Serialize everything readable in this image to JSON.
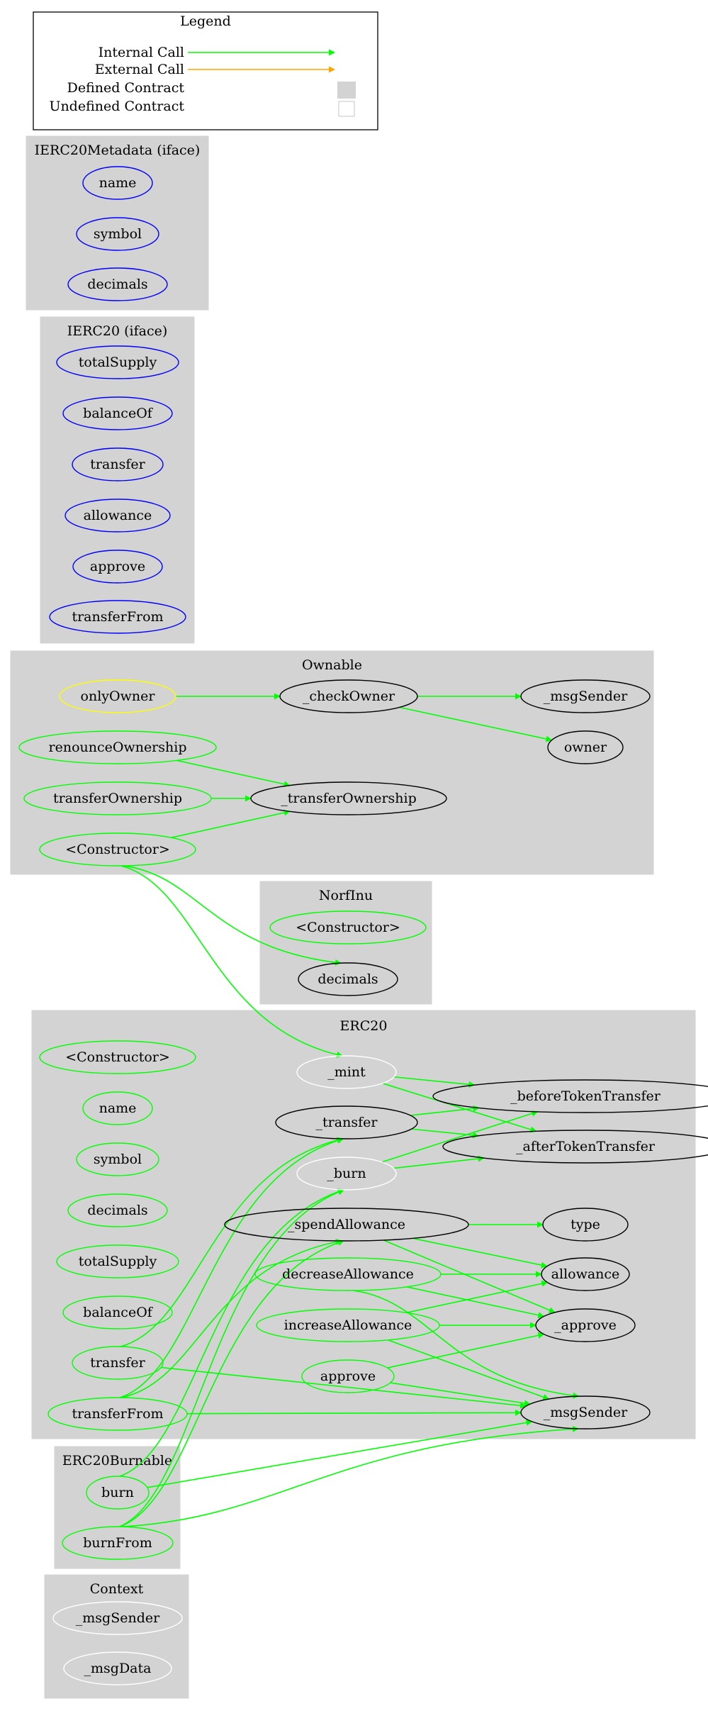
{
  "legend": {
    "title": "Legend",
    "items": [
      {
        "label": "Internal Call",
        "kind": "arrow",
        "color": "#00ff00"
      },
      {
        "label": "External Call",
        "kind": "arrow",
        "color": "#ffa500"
      },
      {
        "label": "Defined Contract",
        "kind": "box",
        "color": "#d3d3d3"
      },
      {
        "label": "Undefined Contract",
        "kind": "box",
        "color": "#ffffff"
      }
    ]
  },
  "colors": {
    "internal_call": "#00ff00",
    "external_call": "#ffa500",
    "defined_contract": "#d3d3d3",
    "iface_function": "#0000ff",
    "public_function": "#00ff00",
    "modifier": "#ffff00",
    "internal_function": "#000000",
    "undefined_function": "#ffffff"
  },
  "clusters": [
    {
      "id": "IERC20Metadata",
      "label": "IERC20Metadata  (iface)"
    },
    {
      "id": "IERC20",
      "label": "IERC20  (iface)"
    },
    {
      "id": "Ownable",
      "label": "Ownable"
    },
    {
      "id": "NorfInu",
      "label": "NorfInu"
    },
    {
      "id": "ERC20",
      "label": "ERC20"
    },
    {
      "id": "ERC20Burnable",
      "label": "ERC20Burnable"
    },
    {
      "id": "Context",
      "label": "Context"
    }
  ],
  "nodes": [
    {
      "id": "md_name",
      "cluster": "IERC20Metadata",
      "label": "name",
      "type": "iface"
    },
    {
      "id": "md_symbol",
      "cluster": "IERC20Metadata",
      "label": "symbol",
      "type": "iface"
    },
    {
      "id": "md_decimals",
      "cluster": "IERC20Metadata",
      "label": "decimals",
      "type": "iface"
    },
    {
      "id": "i_totalSupply",
      "cluster": "IERC20",
      "label": "totalSupply",
      "type": "iface"
    },
    {
      "id": "i_balanceOf",
      "cluster": "IERC20",
      "label": "balanceOf",
      "type": "iface"
    },
    {
      "id": "i_transfer",
      "cluster": "IERC20",
      "label": "transfer",
      "type": "iface"
    },
    {
      "id": "i_allowance",
      "cluster": "IERC20",
      "label": "allowance",
      "type": "iface"
    },
    {
      "id": "i_approve",
      "cluster": "IERC20",
      "label": "approve",
      "type": "iface"
    },
    {
      "id": "i_transferFrom",
      "cluster": "IERC20",
      "label": "transferFrom",
      "type": "iface"
    },
    {
      "id": "o_onlyOwner",
      "cluster": "Ownable",
      "label": "onlyOwner",
      "type": "modifier"
    },
    {
      "id": "o_checkOwner",
      "cluster": "Ownable",
      "label": "_checkOwner",
      "type": "internal"
    },
    {
      "id": "o_msgSender",
      "cluster": "Ownable",
      "label": "_msgSender",
      "type": "internal"
    },
    {
      "id": "o_owner",
      "cluster": "Ownable",
      "label": "owner",
      "type": "internal"
    },
    {
      "id": "o_renounce",
      "cluster": "Ownable",
      "label": "renounceOwnership",
      "type": "public"
    },
    {
      "id": "o_transferOwnership",
      "cluster": "Ownable",
      "label": "transferOwnership",
      "type": "public"
    },
    {
      "id": "o_internalTransferOwnership",
      "cluster": "Ownable",
      "label": "_transferOwnership",
      "type": "internal"
    },
    {
      "id": "o_constructor",
      "cluster": "Ownable",
      "label": "<Constructor>",
      "type": "public"
    },
    {
      "id": "n_constructor",
      "cluster": "NorfInu",
      "label": "<Constructor>",
      "type": "public"
    },
    {
      "id": "n_decimals",
      "cluster": "NorfInu",
      "label": "decimals",
      "type": "internal"
    },
    {
      "id": "e_constructor",
      "cluster": "ERC20",
      "label": "<Constructor>",
      "type": "public"
    },
    {
      "id": "e_name",
      "cluster": "ERC20",
      "label": "name",
      "type": "public"
    },
    {
      "id": "e_symbol",
      "cluster": "ERC20",
      "label": "symbol",
      "type": "public"
    },
    {
      "id": "e_decimals",
      "cluster": "ERC20",
      "label": "decimals",
      "type": "public"
    },
    {
      "id": "e_totalSupply",
      "cluster": "ERC20",
      "label": "totalSupply",
      "type": "public"
    },
    {
      "id": "e_balanceOf",
      "cluster": "ERC20",
      "label": "balanceOf",
      "type": "public"
    },
    {
      "id": "e_transfer",
      "cluster": "ERC20",
      "label": "transfer",
      "type": "public"
    },
    {
      "id": "e_transferFrom",
      "cluster": "ERC20",
      "label": "transferFrom",
      "type": "public"
    },
    {
      "id": "e_mint",
      "cluster": "ERC20",
      "label": "_mint",
      "type": "undefined"
    },
    {
      "id": "e_itransfer",
      "cluster": "ERC20",
      "label": "_transfer",
      "type": "internal"
    },
    {
      "id": "e_burn",
      "cluster": "ERC20",
      "label": "_burn",
      "type": "undefined"
    },
    {
      "id": "e_spendAllowance",
      "cluster": "ERC20",
      "label": "_spendAllowance",
      "type": "internal"
    },
    {
      "id": "e_decreaseAllowance",
      "cluster": "ERC20",
      "label": "decreaseAllowance",
      "type": "public"
    },
    {
      "id": "e_increaseAllowance",
      "cluster": "ERC20",
      "label": "increaseAllowance",
      "type": "public"
    },
    {
      "id": "e_approve",
      "cluster": "ERC20",
      "label": "approve",
      "type": "public"
    },
    {
      "id": "e_beforeTT",
      "cluster": "ERC20",
      "label": "_beforeTokenTransfer",
      "type": "internal"
    },
    {
      "id": "e_afterTT",
      "cluster": "ERC20",
      "label": "_afterTokenTransfer",
      "type": "internal"
    },
    {
      "id": "e_type",
      "cluster": "ERC20",
      "label": "type",
      "type": "internal"
    },
    {
      "id": "e_allowance",
      "cluster": "ERC20",
      "label": "allowance",
      "type": "internal"
    },
    {
      "id": "e_iapprove",
      "cluster": "ERC20",
      "label": "_approve",
      "type": "internal"
    },
    {
      "id": "e_msgSender",
      "cluster": "ERC20",
      "label": "_msgSender",
      "type": "internal"
    },
    {
      "id": "b_burn",
      "cluster": "ERC20Burnable",
      "label": "burn",
      "type": "public"
    },
    {
      "id": "b_burnFrom",
      "cluster": "ERC20Burnable",
      "label": "burnFrom",
      "type": "public"
    },
    {
      "id": "c_msgSender",
      "cluster": "Context",
      "label": "_msgSender",
      "type": "undefined"
    },
    {
      "id": "c_msgData",
      "cluster": "Context",
      "label": "_msgData",
      "type": "undefined"
    }
  ],
  "edges": [
    {
      "from": "o_onlyOwner",
      "to": "o_checkOwner",
      "kind": "internal"
    },
    {
      "from": "o_checkOwner",
      "to": "o_msgSender",
      "kind": "internal"
    },
    {
      "from": "o_checkOwner",
      "to": "o_owner",
      "kind": "internal"
    },
    {
      "from": "o_renounce",
      "to": "o_internalTransferOwnership",
      "kind": "internal"
    },
    {
      "from": "o_transferOwnership",
      "to": "o_internalTransferOwnership",
      "kind": "internal"
    },
    {
      "from": "o_constructor",
      "to": "o_internalTransferOwnership",
      "kind": "internal"
    },
    {
      "from": "o_constructor",
      "to": "n_decimals",
      "kind": "internal"
    },
    {
      "from": "o_constructor",
      "to": "e_mint",
      "kind": "internal"
    },
    {
      "from": "e_mint",
      "to": "e_beforeTT",
      "kind": "internal"
    },
    {
      "from": "e_mint",
      "to": "e_afterTT",
      "kind": "internal"
    },
    {
      "from": "e_itransfer",
      "to": "e_beforeTT",
      "kind": "internal"
    },
    {
      "from": "e_itransfer",
      "to": "e_afterTT",
      "kind": "internal"
    },
    {
      "from": "e_burn",
      "to": "e_beforeTT",
      "kind": "internal"
    },
    {
      "from": "e_burn",
      "to": "e_afterTT",
      "kind": "internal"
    },
    {
      "from": "e_spendAllowance",
      "to": "e_type",
      "kind": "internal"
    },
    {
      "from": "e_spendAllowance",
      "to": "e_allowance",
      "kind": "internal"
    },
    {
      "from": "e_spendAllowance",
      "to": "e_iapprove",
      "kind": "internal"
    },
    {
      "from": "e_decreaseAllowance",
      "to": "e_allowance",
      "kind": "internal"
    },
    {
      "from": "e_decreaseAllowance",
      "to": "e_iapprove",
      "kind": "internal"
    },
    {
      "from": "e_decreaseAllowance",
      "to": "e_msgSender",
      "kind": "internal"
    },
    {
      "from": "e_increaseAllowance",
      "to": "e_allowance",
      "kind": "internal"
    },
    {
      "from": "e_increaseAllowance",
      "to": "e_iapprove",
      "kind": "internal"
    },
    {
      "from": "e_increaseAllowance",
      "to": "e_msgSender",
      "kind": "internal"
    },
    {
      "from": "e_approve",
      "to": "e_iapprove",
      "kind": "internal"
    },
    {
      "from": "e_approve",
      "to": "e_msgSender",
      "kind": "internal"
    },
    {
      "from": "e_transfer",
      "to": "e_itransfer",
      "kind": "internal"
    },
    {
      "from": "e_transfer",
      "to": "e_msgSender",
      "kind": "internal"
    },
    {
      "from": "e_transferFrom",
      "to": "e_itransfer",
      "kind": "internal"
    },
    {
      "from": "e_transferFrom",
      "to": "e_spendAllowance",
      "kind": "internal"
    },
    {
      "from": "e_transferFrom",
      "to": "e_msgSender",
      "kind": "internal"
    },
    {
      "from": "b_burn",
      "to": "e_burn",
      "kind": "internal"
    },
    {
      "from": "b_burn",
      "to": "e_msgSender",
      "kind": "internal"
    },
    {
      "from": "b_burnFrom",
      "to": "e_burn",
      "kind": "internal"
    },
    {
      "from": "b_burnFrom",
      "to": "e_spendAllowance",
      "kind": "internal"
    },
    {
      "from": "b_burnFrom",
      "to": "e_msgSender",
      "kind": "internal"
    }
  ]
}
